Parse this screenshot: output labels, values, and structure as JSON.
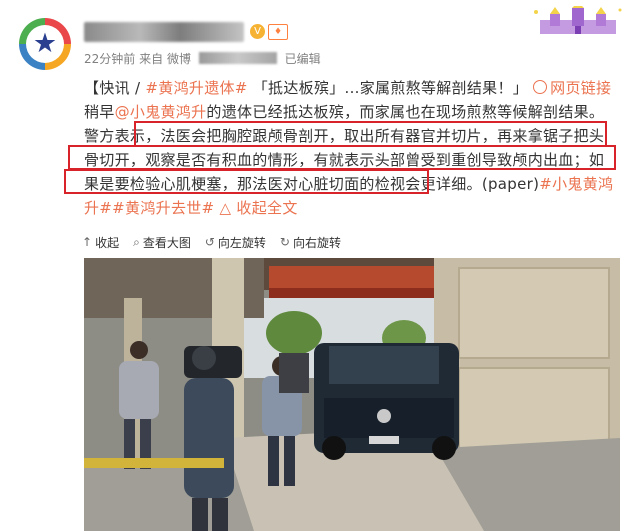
{
  "post": {
    "time": "22分钟前",
    "source_prefix": "来自",
    "source": "微博",
    "edited": "已编辑",
    "badge": "快讯",
    "slash": " / ",
    "hashtag1": "#黄鸿升遗体#",
    "title": "「抵达板殡」...家属煎熬等解剖结果！」",
    "web_link": "网页链接",
    "text_pre": "稍早",
    "mention": "@小鬼黄鸿升",
    "text_main": "的遗体已经抵达板殡，而家属也在现场煎熬等候解剖结果。警方表示，法医会把胸腔跟颅骨剖开，取出所有器官并切片，再来拿锯子把头骨切开，观察是否有积血的情形，有就表示头部曾受到重创导致颅内出血；如果是要检验心肌梗塞，那法医对心脏切面的检视会更详细。",
    "paper": "(paper)",
    "hashtag2": "#小鬼黄鸿升#",
    "hashtag3": "#黄鸿升去世#",
    "collapse": "收起全文"
  },
  "toolbar": {
    "collapse": "收起",
    "view_large": "查看大图",
    "rotate_left": "向左旋转",
    "rotate_right": "向右旋转"
  },
  "icons": {
    "verified": "verified-icon",
    "level": "level-badge-icon",
    "web_link": "web-link-icon"
  },
  "colors": {
    "link": "#eb7350",
    "highlight_box": "#d9232a"
  }
}
